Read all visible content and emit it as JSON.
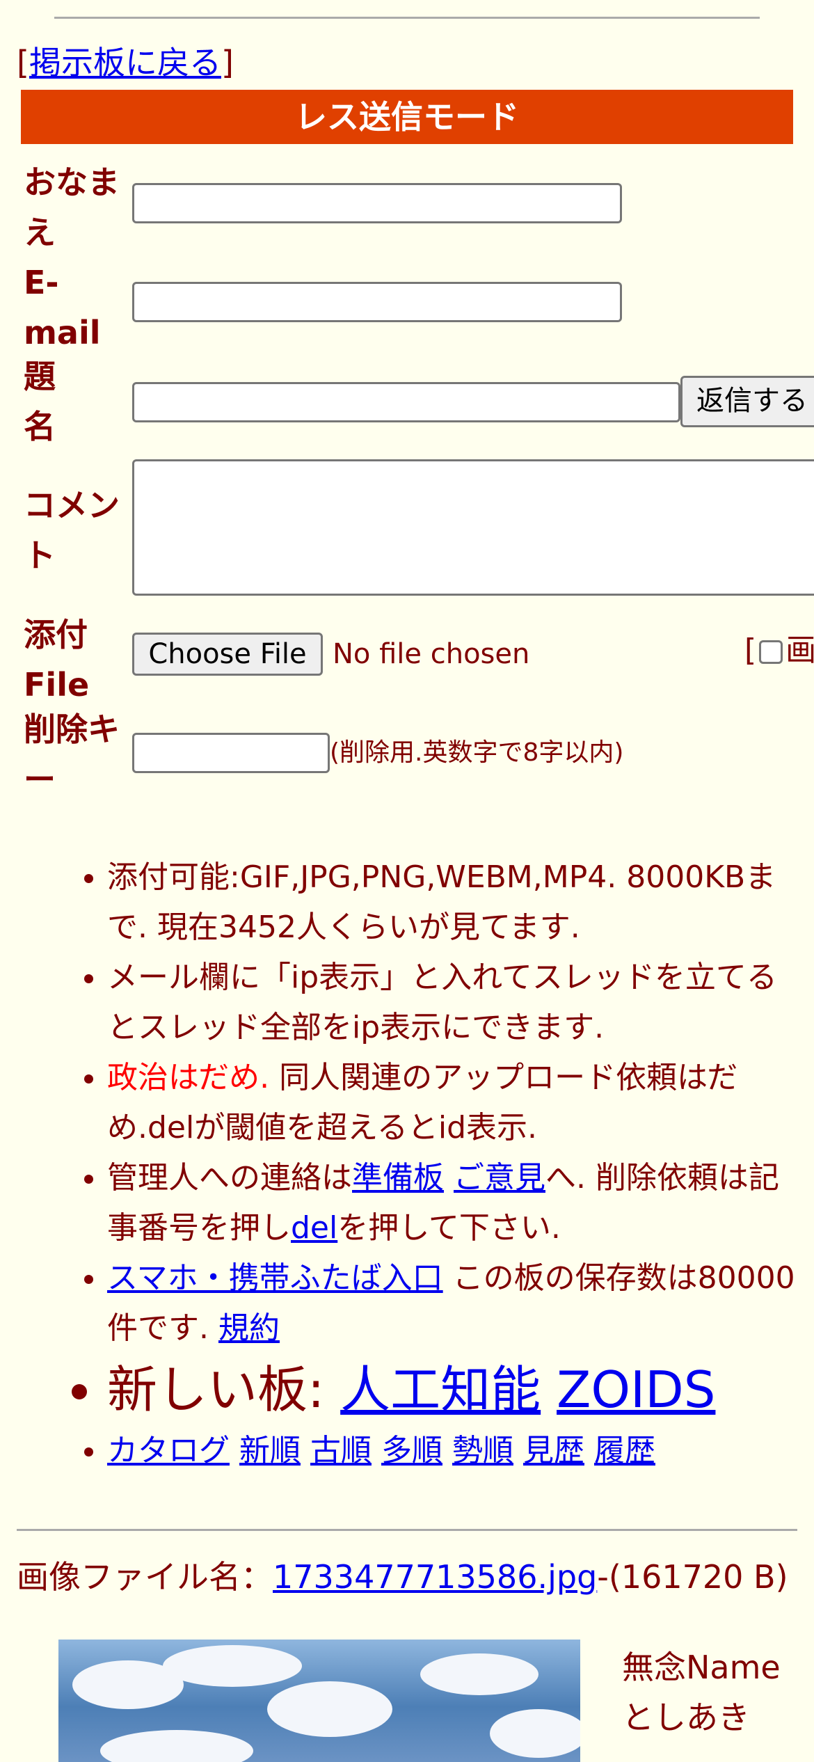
{
  "nav": {
    "back_prefix": "[",
    "back_link": "掲示板に戻る",
    "back_suffix": "]"
  },
  "mode_title": "レス送信モード",
  "form": {
    "name_label": "おなまえ",
    "email_label": "E-mail",
    "subject_label": "題名",
    "submit_label": "返信する",
    "comment_label": "コメント",
    "file_label": "添付File",
    "choose_file_label": "Choose File",
    "no_file_text": "No file chosen",
    "image_option_prefix": "[",
    "image_option_label": "画",
    "delkey_label": "削除キー",
    "delkey_note": "(削除用.英数字で8字以内)"
  },
  "rules": {
    "r1": "添付可能:GIF,JPG,PNG,WEBM,MP4. 8000KBまで. 現在3452人くらいが見てます.",
    "r2": "メール欄に「ip表示」と入れてスレッドを立てるとスレッド全部をip表示にできます.",
    "r3_red": "政治はだめ.",
    "r3_rest": " 同人関連のアップロード依頼はだめ.delが閾値を超えるとid表示.",
    "r4_a": "管理人への連絡は",
    "r4_link1": "準備板",
    "r4_link2": "ご意見",
    "r4_b": "へ. 削除依頼は記事番号を押し",
    "r4_link3": "del",
    "r4_c": "を押して下さい.",
    "r5_link1": "スマホ・携帯ふたば入口",
    "r5_text": " この板の保存数は80000件です. ",
    "r5_link2": "規約",
    "r6_text": "新しい板: ",
    "r6_link1": "人工知能",
    "r6_link2": "ZOIDS",
    "r7_links": [
      "カタログ",
      "新順",
      "古順",
      "多順",
      "勢順",
      "見歴",
      "履歴"
    ]
  },
  "post": {
    "file_prefix": "画像ファイル名：",
    "file_name": "1733477713586.jpg",
    "file_size": "-(161720 B)",
    "subject": "無念",
    "name": "Name",
    "author": "としあき"
  }
}
